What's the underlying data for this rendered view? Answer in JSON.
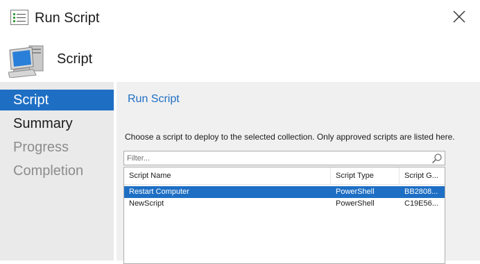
{
  "window": {
    "title": "Run Script",
    "icon": "list-window-icon",
    "close_icon": "close-icon"
  },
  "header": {
    "title": "Script",
    "icon": "computer-icon"
  },
  "nav": {
    "items": [
      {
        "label": "Script",
        "state": "active"
      },
      {
        "label": "Summary",
        "state": "enabled"
      },
      {
        "label": "Progress",
        "state": "disabled"
      },
      {
        "label": "Completion",
        "state": "disabled"
      }
    ]
  },
  "main": {
    "title": "Run Script",
    "instructions": "Choose a script to deploy to the selected collection. Only approved scripts are listed here.",
    "filter": {
      "placeholder": "Filter...",
      "value": ""
    },
    "table": {
      "columns": [
        "Script Name",
        "Script Type",
        "Script G..."
      ],
      "rows": [
        {
          "cells": [
            "Restart Computer",
            "PowerShell",
            "BB2808..."
          ],
          "selected": true
        },
        {
          "cells": [
            "NewScript",
            "PowerShell",
            "C19E56..."
          ],
          "selected": false
        }
      ]
    }
  },
  "colors": {
    "accent": "#1e6fc4",
    "nav_background": "#eaeaea",
    "content_background": "#f0f0f0",
    "disabled_text": "#8c8c8c"
  }
}
